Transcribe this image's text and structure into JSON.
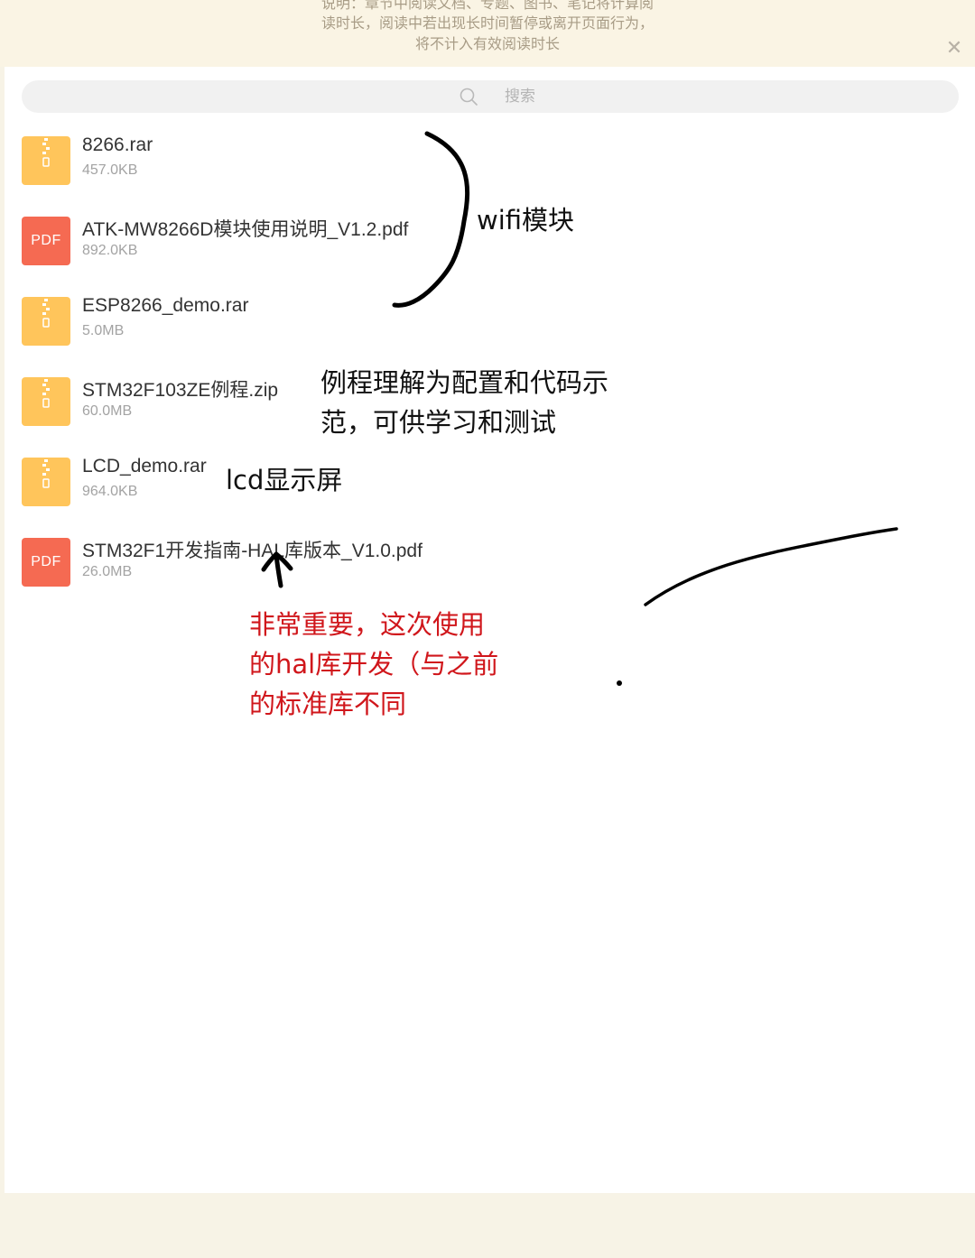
{
  "notice": {
    "lines": [
      "说明：章节中阅读文档、专题、图书、笔记将计算阅",
      "读时长，阅读中若出现长时间暂停或离开页面行为，",
      "将不计入有效阅读时长"
    ],
    "close_glyph": "✕"
  },
  "search": {
    "placeholder": "搜索",
    "icon": "search-icon"
  },
  "files": [
    {
      "name": "8266.rar",
      "size": "457.0KB",
      "type": "zip"
    },
    {
      "name": "ATK-MW8266D模块使用说明_V1.2.pdf",
      "size": "892.0KB",
      "type": "pdf",
      "badge": "PDF"
    },
    {
      "name": "ESP8266_demo.rar",
      "size": "5.0MB",
      "type": "zip"
    },
    {
      "name": "STM32F103ZE例程.zip",
      "size": "60.0MB",
      "type": "zip"
    },
    {
      "name": "LCD_demo.rar",
      "size": "964.0KB",
      "type": "zip"
    },
    {
      "name": "STM32F1开发指南-HAL库版本_V1.0.pdf",
      "size": "26.0MB",
      "type": "pdf",
      "badge": "PDF"
    }
  ],
  "annotations": {
    "wifi": "wifi模块",
    "demo_line1": "例程理解为配置和代码示",
    "demo_line2": "范，可供学习和测试",
    "lcd": "lcd显示屏",
    "important_line1": "非常重要，这次使用",
    "important_line2": "的hal库开发（与之前",
    "important_line3": "的标准库不同"
  },
  "colors": {
    "notice_bg": "#faf4e4",
    "zip_icon": "#ffc55b",
    "pdf_icon": "#f56a52",
    "annotation_red": "#d0161b"
  }
}
